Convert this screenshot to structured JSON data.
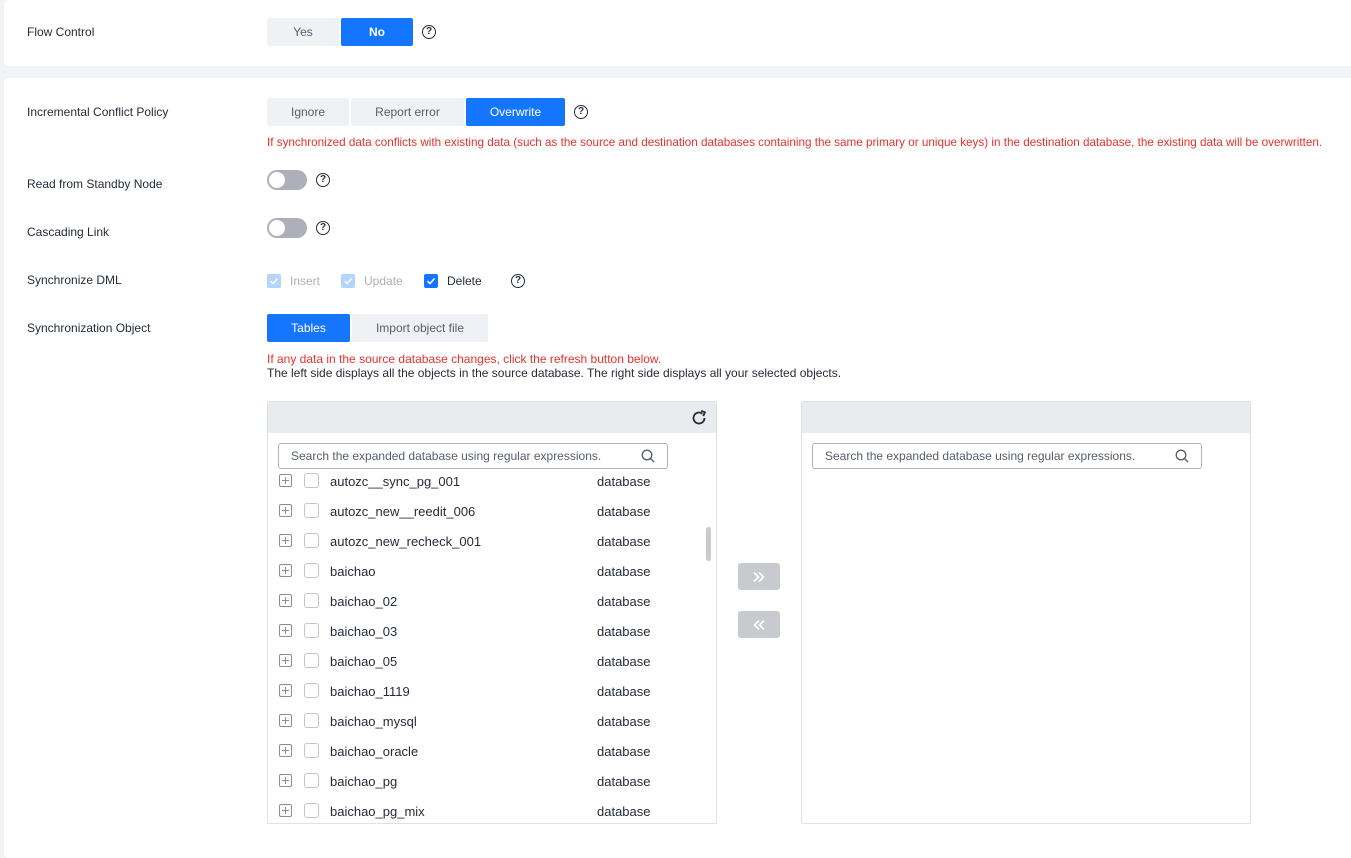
{
  "flow_control": {
    "label": "Flow Control",
    "options": [
      "Yes",
      "No"
    ],
    "selected": "No"
  },
  "conflict_policy": {
    "label": "Incremental Conflict Policy",
    "options": [
      "Ignore",
      "Report error",
      "Overwrite"
    ],
    "selected": "Overwrite",
    "note": "If synchronized data conflicts with existing data (such as the source and destination databases containing the same primary or unique keys) in the destination database, the existing data will be overwritten."
  },
  "standby_node": {
    "label": "Read from Standby Node",
    "enabled": false
  },
  "cascading_link": {
    "label": "Cascading Link",
    "enabled": false
  },
  "sync_dml": {
    "label": "Synchronize DML",
    "options": [
      {
        "label": "Insert",
        "checked": true,
        "disabled": true
      },
      {
        "label": "Update",
        "checked": true,
        "disabled": true
      },
      {
        "label": "Delete",
        "checked": true,
        "disabled": false
      }
    ]
  },
  "sync_object": {
    "label": "Synchronization Object",
    "options": [
      "Tables",
      "Import object file"
    ],
    "selected": "Tables",
    "note_red": "If any data in the source database changes, click the refresh button below.",
    "note_black": "The left side displays all the objects in the source database. The right side displays all your selected objects."
  },
  "left_panel": {
    "search_placeholder": "Search the expanded database using regular expressions.",
    "items": [
      {
        "name": "autozc__sync_pg_001",
        "type": "database"
      },
      {
        "name": "autozc_new__reedit_006",
        "type": "database"
      },
      {
        "name": "autozc_new_recheck_001",
        "type": "database"
      },
      {
        "name": "baichao",
        "type": "database"
      },
      {
        "name": "baichao_02",
        "type": "database"
      },
      {
        "name": "baichao_03",
        "type": "database"
      },
      {
        "name": "baichao_05",
        "type": "database"
      },
      {
        "name": "baichao_1119",
        "type": "database"
      },
      {
        "name": "baichao_mysql",
        "type": "database"
      },
      {
        "name": "baichao_oracle",
        "type": "database"
      },
      {
        "name": "baichao_pg",
        "type": "database"
      },
      {
        "name": "baichao_pg_mix",
        "type": "database"
      }
    ]
  },
  "right_panel": {
    "search_placeholder": "Search the expanded database using regular expressions."
  },
  "icons": {
    "help": "help-circle-icon",
    "refresh": "refresh-icon",
    "search": "search-icon",
    "move_right": "double-chevron-right-icon",
    "move_left": "double-chevron-left-icon",
    "expand": "plus-square-icon"
  },
  "colors": {
    "primary": "#1476ff",
    "warning_text": "#e6322f",
    "disabled_check": "#b3d4ff"
  }
}
